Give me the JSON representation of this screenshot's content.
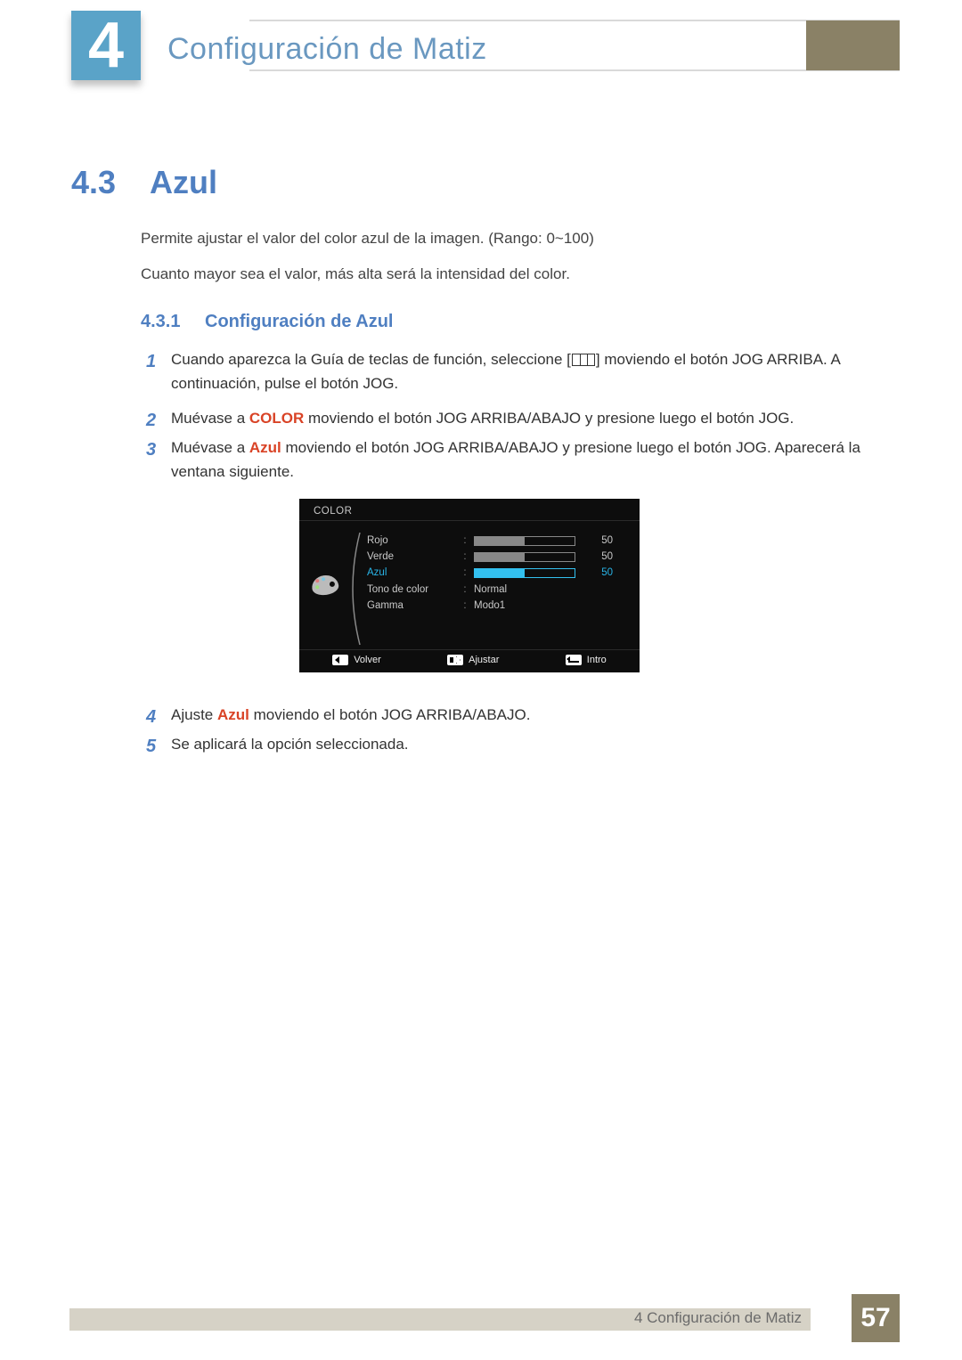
{
  "chapter": {
    "number": "4",
    "title": "Configuración de Matiz"
  },
  "section": {
    "number": "4.3",
    "title": "Azul"
  },
  "paragraphs": {
    "p1": "Permite ajustar el valor del color azul de la imagen. (Rango: 0~100)",
    "p2": "Cuanto mayor sea el valor, más alta será la intensidad del color."
  },
  "subsection": {
    "number": "4.3.1",
    "title": "Configuración de Azul"
  },
  "steps": {
    "s1_num": "1",
    "s1_pre": "Cuando aparezca la Guía de teclas de función, seleccione [",
    "s1_post": "] moviendo el botón JOG ARRIBA. A continuación, pulse el botón JOG.",
    "s2_num": "2",
    "s2_pre": "Muévase a ",
    "s2_key": "COLOR",
    "s2_post": " moviendo el botón JOG ARRIBA/ABAJO y presione luego el botón JOG.",
    "s3_num": "3",
    "s3_pre": "Muévase a ",
    "s3_key": "Azul",
    "s3_post": " moviendo el botón JOG ARRIBA/ABAJO y presione luego el botón JOG. Aparecerá la ventana siguiente.",
    "s4_num": "4",
    "s4_pre": "Ajuste ",
    "s4_key": "Azul",
    "s4_post": " moviendo el botón JOG ARRIBA/ABAJO.",
    "s5_num": "5",
    "s5_text": "Se aplicará la opción seleccionada."
  },
  "osd": {
    "title": "COLOR",
    "rows": {
      "rojo": {
        "label": "Rojo",
        "value": "50"
      },
      "verde": {
        "label": "Verde",
        "value": "50"
      },
      "azul": {
        "label": "Azul",
        "value": "50"
      },
      "tono": {
        "label": "Tono de color",
        "value": "Normal"
      },
      "gamma": {
        "label": "Gamma",
        "value": "Modo1"
      }
    },
    "footer": {
      "back": "Volver",
      "adjust": "Ajustar",
      "enter": "Intro"
    }
  },
  "footer": {
    "text": "4 Configuración de Matiz",
    "page": "57"
  }
}
